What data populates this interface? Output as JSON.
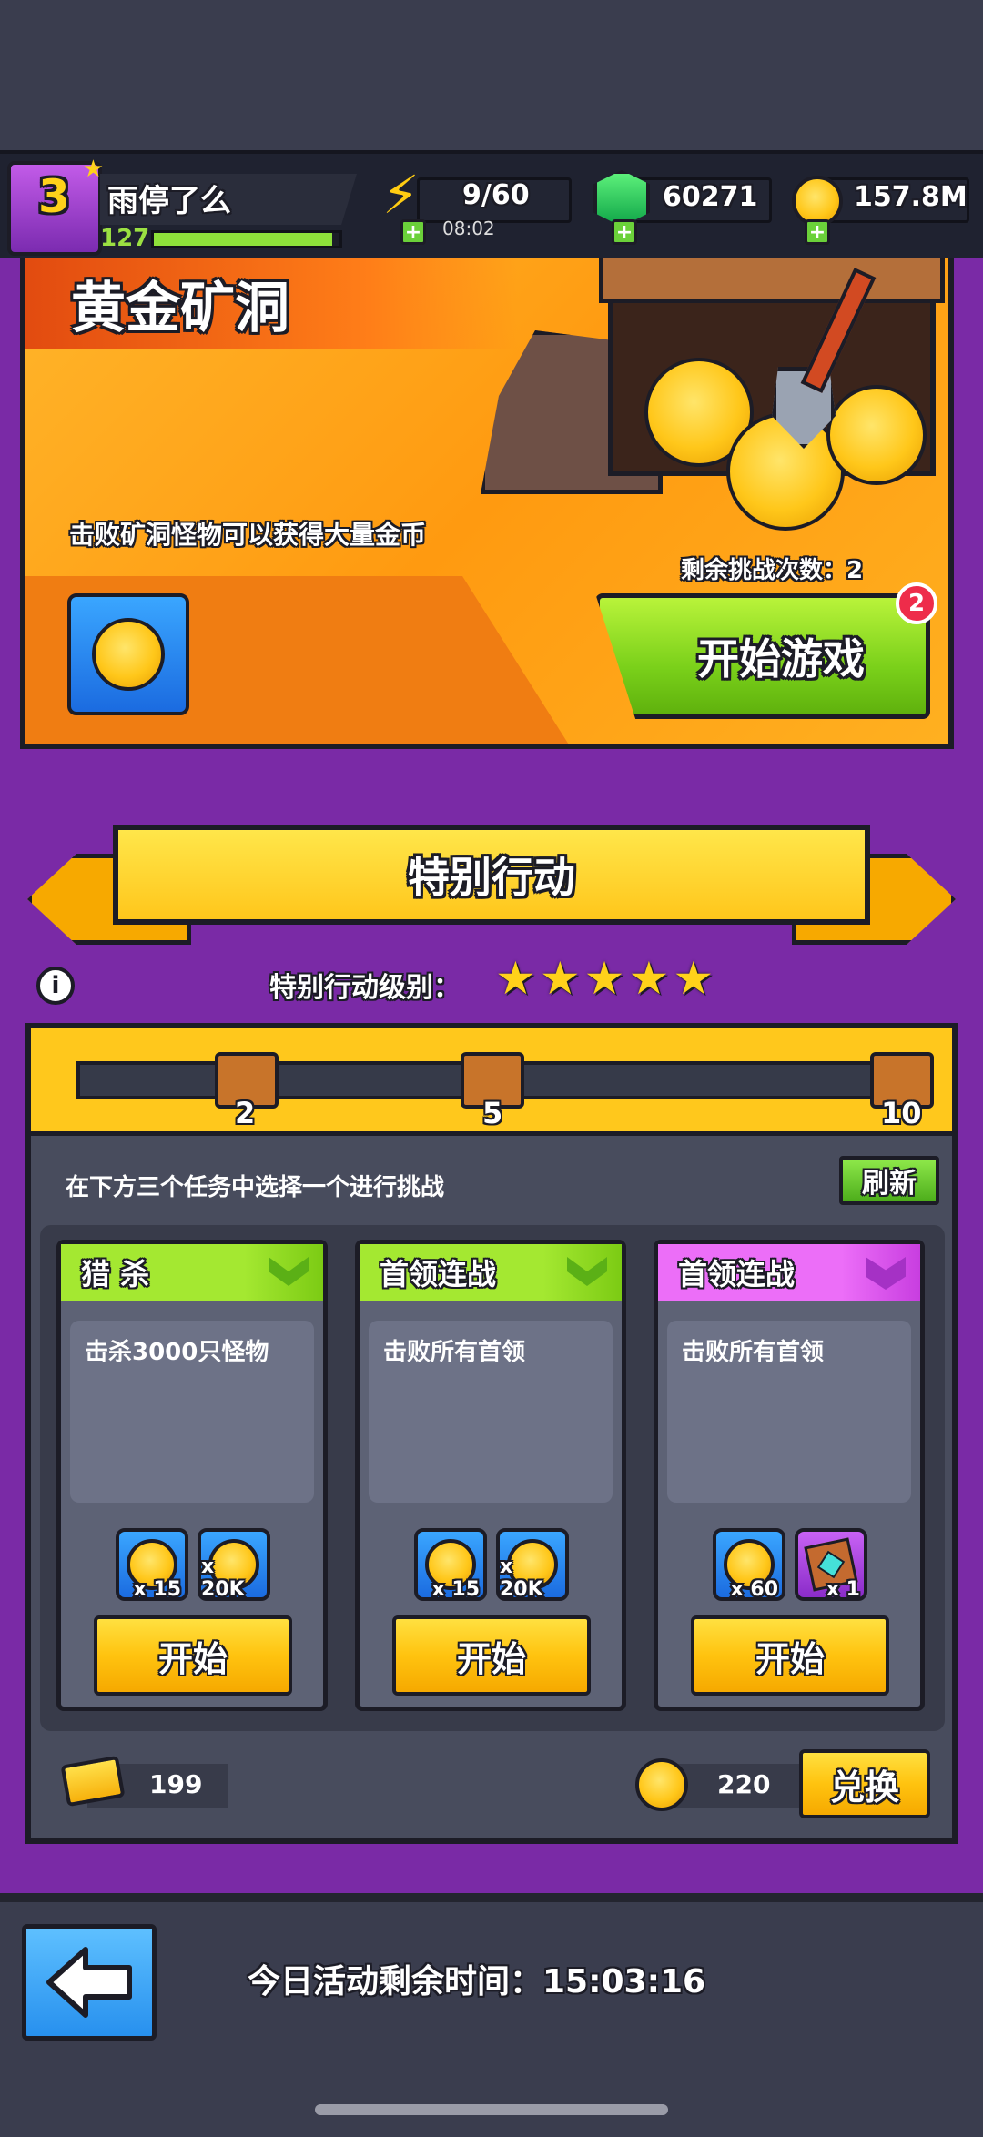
{
  "header": {
    "level_badge": "3",
    "player_name": "雨停了么",
    "player_level": "127",
    "energy": "9/60",
    "energy_timer": "08:02",
    "gems": "60271",
    "gold": "157.8M"
  },
  "gold_mine": {
    "title": "黄金矿洞",
    "description": "击败矿洞怪物可以获得大量金币",
    "remaining_label": "剩余挑战次数：2",
    "start_button": "开始游戏",
    "badge_count": "2"
  },
  "special": {
    "banner_title": "特别行动",
    "level_label": "特别行动级别：",
    "stars": 5,
    "milestones": [
      "2",
      "5",
      "10"
    ],
    "instruction": "在下方三个任务中选择一个进行挑战",
    "refresh_button": "刷新",
    "tasks": [
      {
        "name": "猎 杀",
        "desc": "击杀3000只怪物",
        "rewards": [
          {
            "icon": "token-coin-icon",
            "qty": "x 15"
          },
          {
            "icon": "gold-coin-icon",
            "qty": "x 20K"
          }
        ],
        "button": "开始",
        "color": "#9ae81e"
      },
      {
        "name": "首领连战",
        "desc": "击败所有首领",
        "rewards": [
          {
            "icon": "token-coin-icon",
            "qty": "x 15"
          },
          {
            "icon": "gold-coin-icon",
            "qty": "x 20K"
          }
        ],
        "button": "开始",
        "color": "#9ae81e"
      },
      {
        "name": "首领连战",
        "desc": "击败所有首领",
        "rewards": [
          {
            "icon": "token-coin-icon",
            "qty": "x 60"
          },
          {
            "icon": "gem-card-icon",
            "qty": "x 1"
          }
        ],
        "button": "开始",
        "color": "#e25ff0"
      }
    ],
    "ticket_count": "199",
    "token_count": "220",
    "exchange_button": "兑换"
  },
  "footer": {
    "timer_label": "今日活动剩余时间：15:03:16"
  }
}
